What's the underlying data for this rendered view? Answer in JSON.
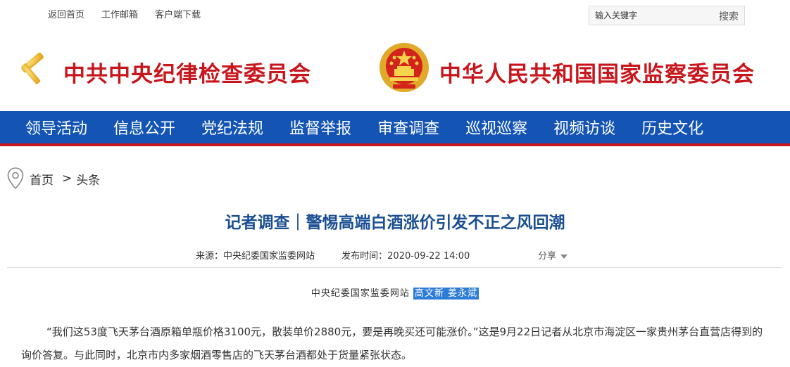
{
  "topbar": {
    "links": [
      "返回首页",
      "工作邮箱",
      "客户端下载"
    ],
    "search_placeholder": "输入关键字",
    "search_button": "搜索"
  },
  "header": {
    "org1": "中共中央纪律检查委员会",
    "org2": "中华人民共和国国家监察委员会"
  },
  "nav": {
    "items": [
      "领导活动",
      "信息公开",
      "党纪法规",
      "监督举报",
      "审查调查",
      "巡视巡察",
      "视频访谈",
      "历史文化"
    ]
  },
  "breadcrumb": {
    "home": "首页",
    "separator": ">",
    "current": "头条"
  },
  "article": {
    "title": "记者调查｜警惕高端白酒涨价引发不正之风回潮",
    "source": "来源：中央纪委国家监委网站",
    "pubtime": "发布时间：2020-09-22 14:00",
    "share": "分享",
    "byline_site": "中央纪委国家监委网站",
    "byline_authors": "高文新 姜永斌",
    "paragraph": "“我们这53度飞天茅台酒原箱单瓶价格3100元，散装单价2880元，要是再晚买还可能涨价。”这是9月22日记者从北京市海淀区一家贵州茅台直营店得到的询价答复。与此同时，北京市内多家烟酒零售店的飞天茅台酒都处于货量紧张状态。"
  },
  "colors": {
    "brand_red": "#c8161d",
    "nav_blue": "#1354b5",
    "title_blue": "#1a4f91",
    "highlight": "#2d7cd6"
  }
}
